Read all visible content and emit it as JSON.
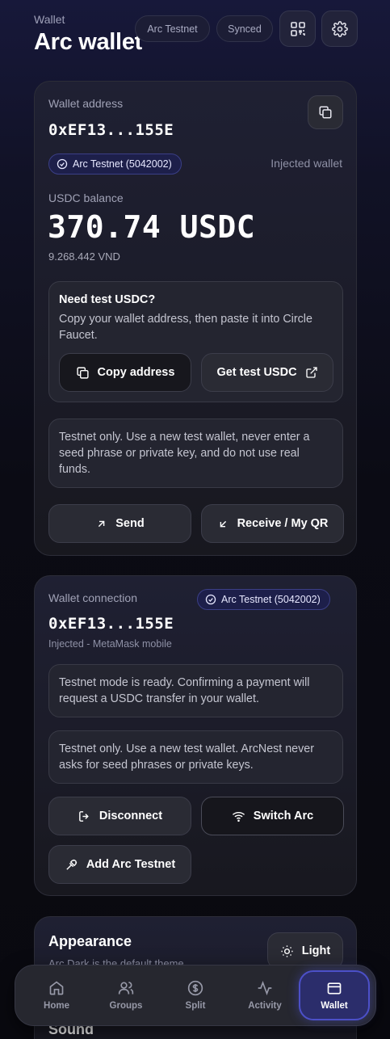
{
  "header": {
    "subtitle": "Wallet",
    "title": "Arc wallet",
    "network_pill": "Arc Testnet",
    "sync_pill": "Synced"
  },
  "wallet_card": {
    "address_label": "Wallet address",
    "address": "0xEF13...155E",
    "network_chip": "Arc Testnet (5042002)",
    "wallet_type": "Injected wallet",
    "balance_label": "USDC balance",
    "balance": "370.74 USDC",
    "balance_fiat": "9.268.442 VND",
    "faucet": {
      "title": "Need test USDC?",
      "text": "Copy your wallet address, then paste it into Circle Faucet.",
      "copy_button": "Copy address",
      "get_button": "Get test USDC"
    },
    "warning": "Testnet only. Use a new test wallet, never enter a seed phrase or private key, and do not use real funds.",
    "send_button": "Send",
    "receive_button": "Receive / My QR"
  },
  "connection_card": {
    "label": "Wallet connection",
    "network_chip": "Arc Testnet (5042002)",
    "address": "0xEF13...155E",
    "provider": "Injected - MetaMask mobile",
    "ready_note": "Testnet mode is ready. Confirming a payment will request a USDC transfer in your wallet.",
    "safety_note": "Testnet only. Use a new test wallet. ArcNest never asks for seed phrases or private keys.",
    "disconnect_button": "Disconnect",
    "switch_button": "Switch Arc",
    "add_button": "Add Arc Testnet"
  },
  "appearance_card": {
    "title": "Appearance",
    "subtitle": "Arc Dark is the default theme.",
    "theme_button": "Light",
    "next_section": "Sound"
  },
  "nav": {
    "items": [
      {
        "label": "Home",
        "icon": "home-icon"
      },
      {
        "label": "Groups",
        "icon": "users-icon"
      },
      {
        "label": "Split",
        "icon": "dollar-icon"
      },
      {
        "label": "Activity",
        "icon": "activity-icon"
      },
      {
        "label": "Wallet",
        "icon": "wallet-icon",
        "active": true
      }
    ]
  },
  "colors": {
    "accent": "#4c50c8",
    "chip_bg": "#1d1f4a",
    "card_bg": "#1f2033"
  }
}
